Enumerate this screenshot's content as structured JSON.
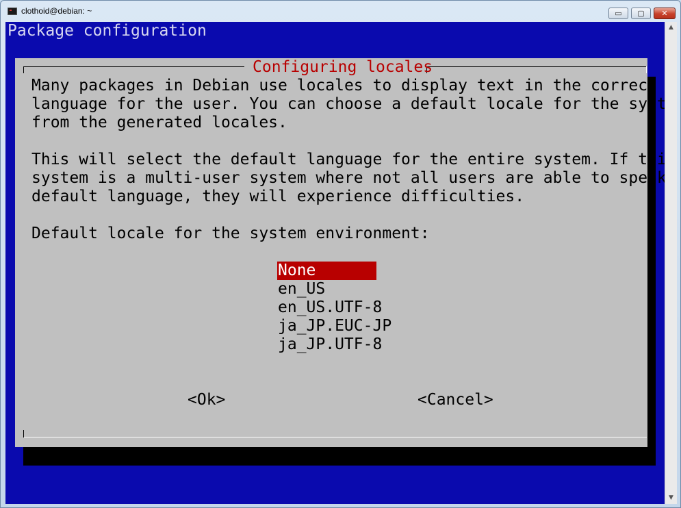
{
  "window": {
    "title": "clothoid@debian: ~",
    "minimize_glyph": "▭",
    "maximize_glyph": "▢",
    "close_glyph": "✕",
    "icon": "terminal-icon"
  },
  "terminal": {
    "header": "Package configuration",
    "background": "#0a0aae"
  },
  "dialog": {
    "title": "Configuring locales",
    "paragraph1": "Many packages in Debian use locales to display text in the correct\nlanguage for the user. You can choose a default locale for the system\nfrom the generated locales.",
    "paragraph2": "This will select the default language for the entire system. If this\nsystem is a multi-user system where not all users are able to speak the\ndefault language, they will experience difficulties.",
    "prompt": "Default locale for the system environment:",
    "options": [
      "None",
      "en_US",
      "en_US.UTF-8",
      "ja_JP.EUC-JP",
      "ja_JP.UTF-8"
    ],
    "selected_option": "None",
    "ok_label": "<Ok>",
    "cancel_label": "<Cancel>",
    "colors": {
      "dialog_bg": "#c0c0c0",
      "title": "#b80000",
      "selection_bg": "#b80000"
    }
  },
  "scrollbar": {
    "up_glyph": "▲",
    "down_glyph": "▼"
  }
}
